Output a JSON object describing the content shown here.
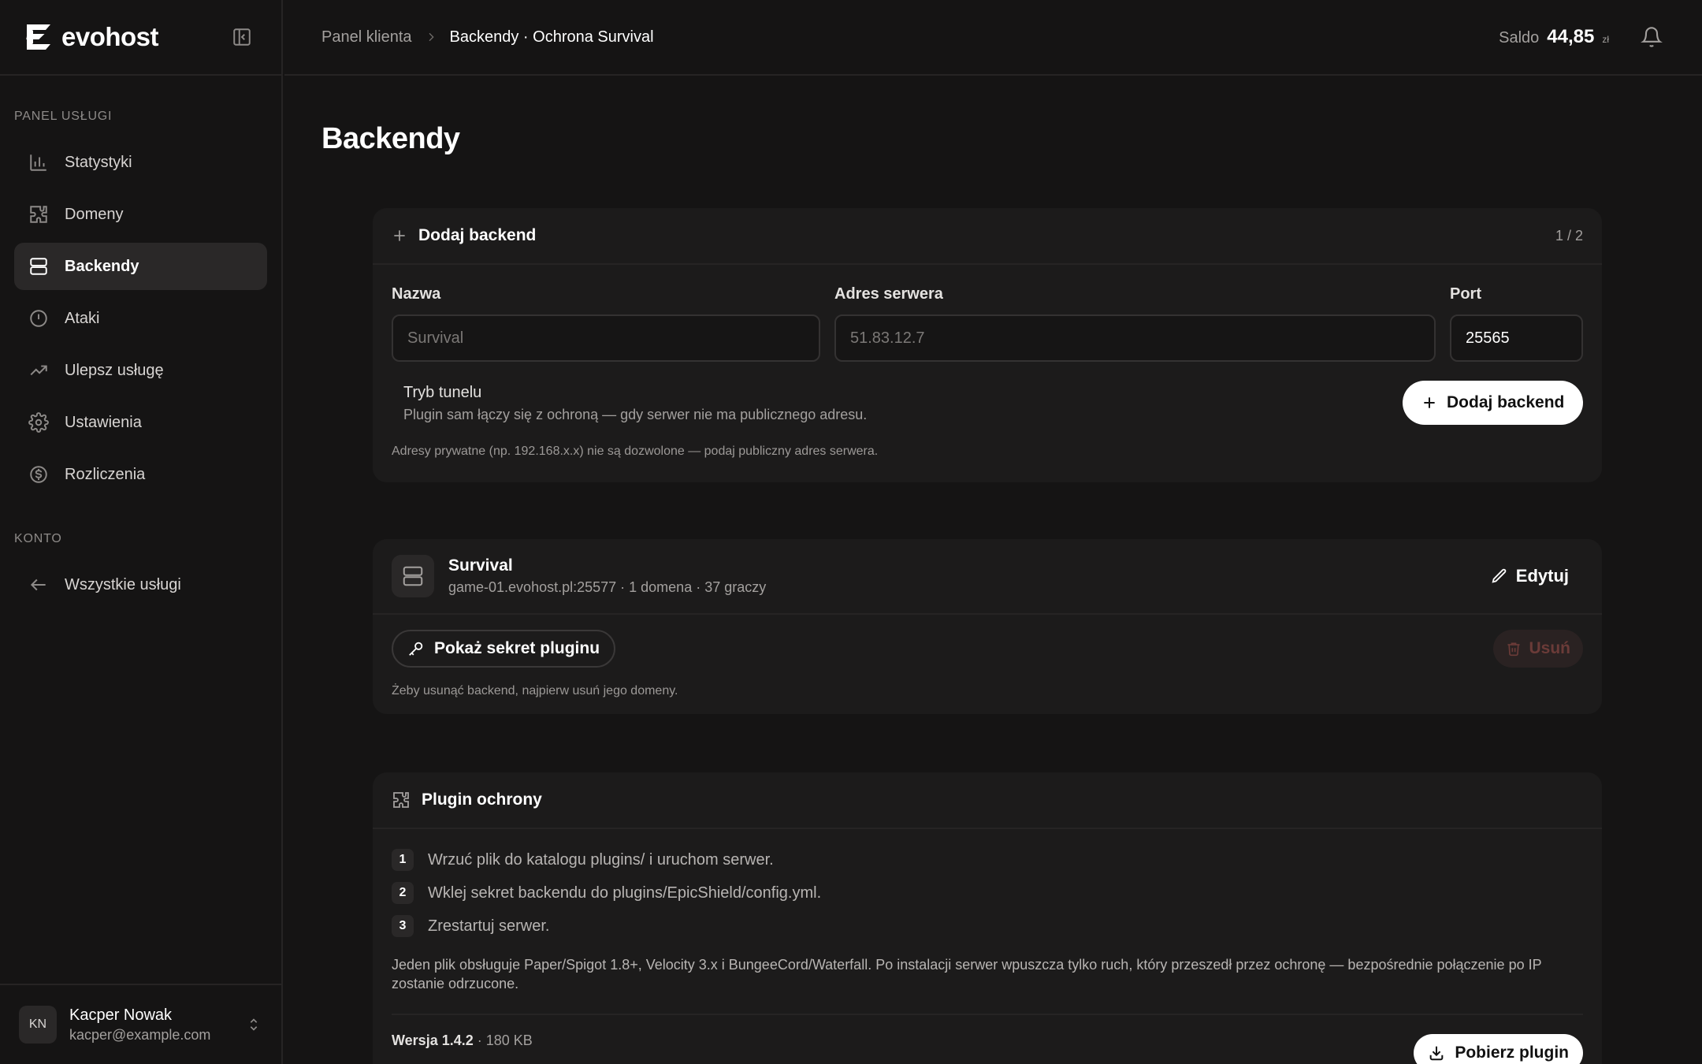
{
  "brand": {
    "name": "evohost"
  },
  "sidebar": {
    "section_service": "PANEL USŁUGI",
    "items": [
      {
        "label": "Statystyki",
        "icon": "bar-chart-icon"
      },
      {
        "label": "Domeny",
        "icon": "puzzle-icon"
      },
      {
        "label": "Backendy",
        "icon": "server-icon",
        "active": true
      },
      {
        "label": "Ataki",
        "icon": "alert-circle-icon"
      },
      {
        "label": "Ulepsz usługę",
        "icon": "trending-up-icon"
      },
      {
        "label": "Ustawienia",
        "icon": "gear-icon"
      },
      {
        "label": "Rozliczenia",
        "icon": "dollar-circle-icon"
      }
    ],
    "section_account": "KONTO",
    "account_items": [
      {
        "label": "Wszystkie usługi",
        "icon": "arrow-left-icon"
      }
    ]
  },
  "user": {
    "initials": "KN",
    "name": "Kacper Nowak",
    "email": "kacper@example.com"
  },
  "topbar": {
    "breadcrumb": [
      "Panel klienta",
      "Backendy · Ochrona Survival"
    ],
    "balance_label": "Saldo",
    "balance_value": "44,85",
    "balance_currency": "zł"
  },
  "page": {
    "title": "Backendy"
  },
  "add_backend": {
    "title": "Dodaj backend",
    "counter": "1 / 2",
    "name_label": "Nazwa",
    "name_placeholder": "Survival",
    "address_label": "Adres serwera",
    "address_placeholder": "51.83.12.7",
    "port_label": "Port",
    "port_value": "25565",
    "tunnel_title": "Tryb tunelu",
    "tunnel_desc": "Plugin sam łączy się z ochroną — gdy serwer nie ma publicznego adresu.",
    "submit_label": "Dodaj backend",
    "note": "Adresy prywatne (np. 192.168.x.x) nie są dozwolone — podaj publiczny adres serwera."
  },
  "backend": {
    "name": "Survival",
    "meta": "game-01.evohost.pl:25577 · 1 domena · 37 graczy",
    "edit_label": "Edytuj",
    "secret_label": "Pokaż sekret pluginu",
    "delete_label": "Usuń",
    "note": "Żeby usunąć backend, najpierw usuń jego domeny."
  },
  "plugin": {
    "title": "Plugin ochrony",
    "steps": [
      {
        "num": "1",
        "text": "Wrzuć plik do katalogu plugins/ i uruchom serwer."
      },
      {
        "num": "2",
        "text": "Wklej sekret backendu do plugins/EpicShield/config.yml."
      },
      {
        "num": "3",
        "text": "Zrestartuj serwer."
      }
    ],
    "description": "Jeden plik obsługuje Paper/Spigot 1.8+, Velocity 3.x i BungeeCord/Waterfall. Po instalacji serwer wpuszcza tylko ruch, który przeszedł przez ochronę — bezpośrednie połączenie po IP zostanie odrzucone.",
    "version_label": "Wersja 1.4.2",
    "size": "· 180 KB",
    "download_label": "Pobierz plugin"
  }
}
